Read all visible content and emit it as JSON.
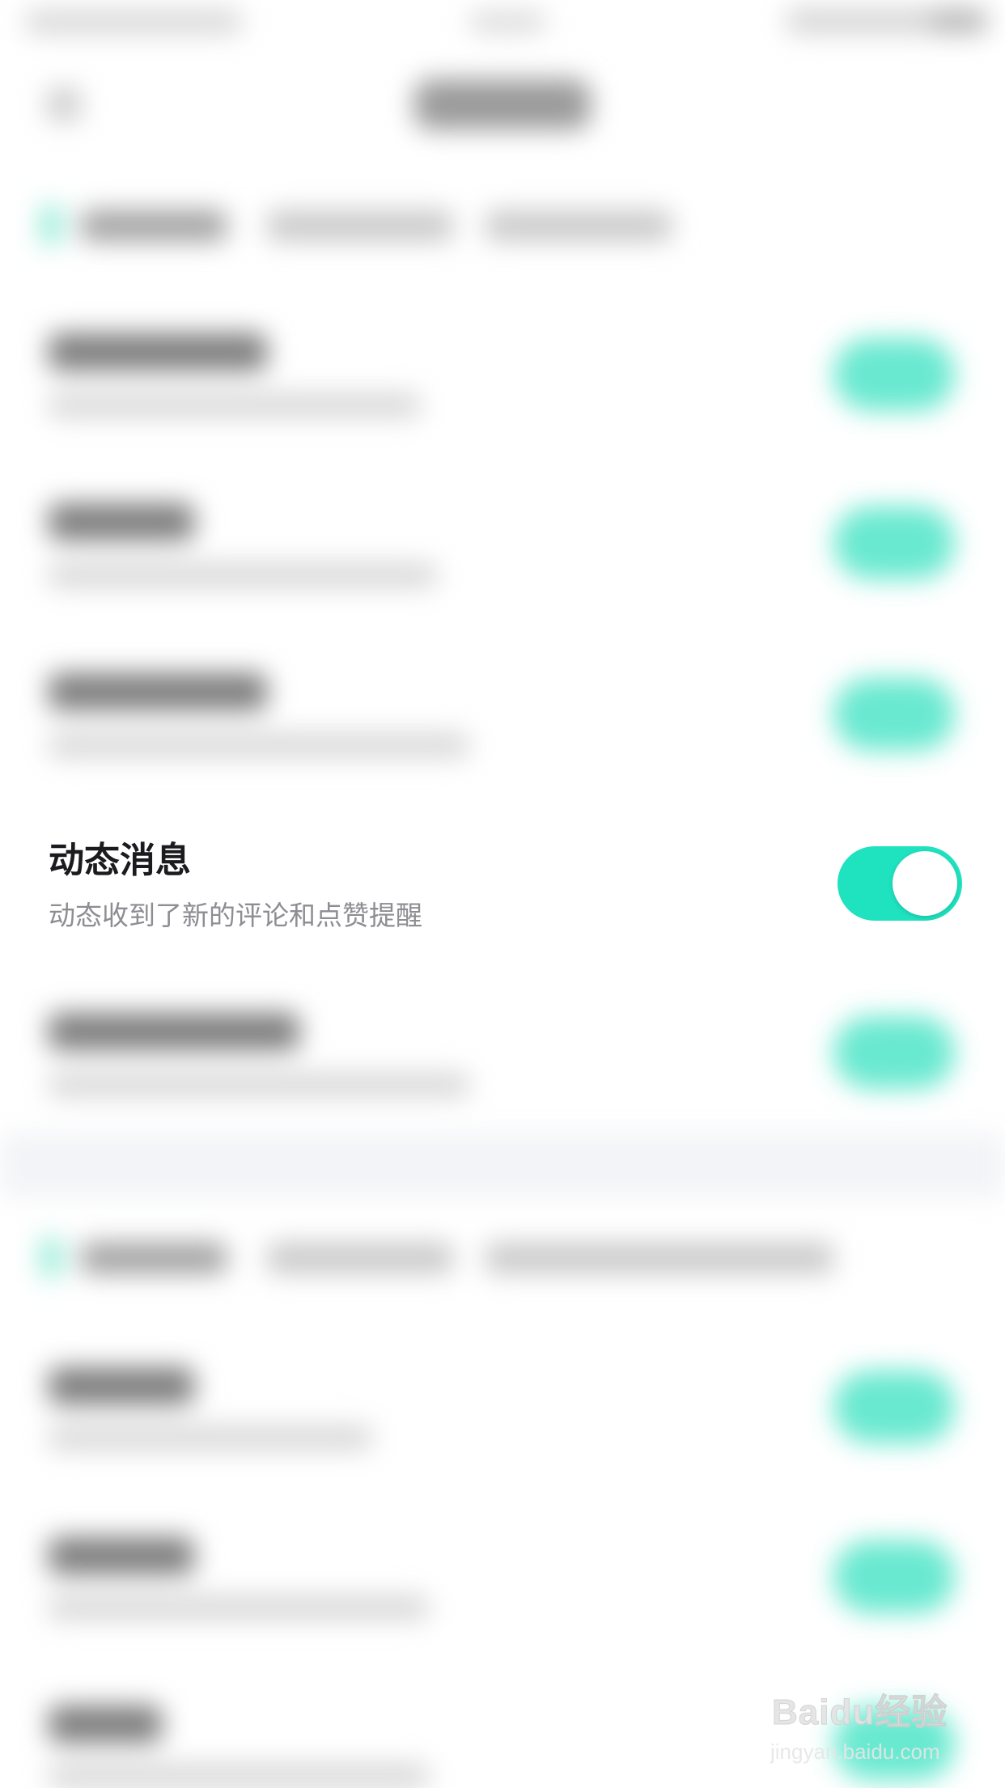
{
  "focused_setting": {
    "title": "动态消息",
    "subtitle": "动态收到了新的评论和点赞提醒",
    "toggle_on": true
  },
  "colors": {
    "accent": "#1fe2bf",
    "title_text": "#1b1b1f",
    "subtitle_text": "#8d8d92",
    "background": "#ffffff"
  },
  "watermark": {
    "logo": "Baidu经验",
    "url": "jingyan.baidu.com"
  },
  "icons": [
    "back-arrow-icon",
    "signal-icon",
    "wifi-icon",
    "battery-icon"
  ]
}
